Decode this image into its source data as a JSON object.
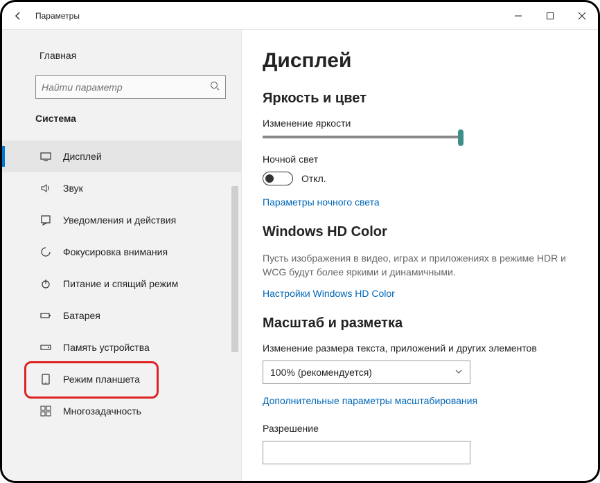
{
  "titlebar": {
    "title": "Параметры"
  },
  "sidebar": {
    "home": "Главная",
    "search_placeholder": "Найти параметр",
    "section": "Система",
    "items": [
      {
        "label": "Дисплей"
      },
      {
        "label": "Звук"
      },
      {
        "label": "Уведомления и действия"
      },
      {
        "label": "Фокусировка внимания"
      },
      {
        "label": "Питание и спящий режим"
      },
      {
        "label": "Батарея"
      },
      {
        "label": "Память устройства"
      },
      {
        "label": "Режим планшета"
      },
      {
        "label": "Многозадачность"
      }
    ]
  },
  "content": {
    "title": "Дисплей",
    "brightness_section": "Яркость и цвет",
    "brightness_label": "Изменение яркости",
    "nightlight_label": "Ночной свет",
    "nightlight_state": "Откл.",
    "nightlight_link": "Параметры ночного света",
    "hdcolor_title": "Windows HD Color",
    "hdcolor_desc": "Пусть изображения в видео, играх и приложениях в режиме HDR и WCG будут более яркими и динамичными.",
    "hdcolor_link": "Настройки Windows HD Color",
    "scale_title": "Масштаб и разметка",
    "scale_label": "Изменение размера текста, приложений и других элементов",
    "scale_value": "100% (рекомендуется)",
    "scale_link": "Дополнительные параметры масштабирования",
    "resolution_label": "Разрешение"
  }
}
